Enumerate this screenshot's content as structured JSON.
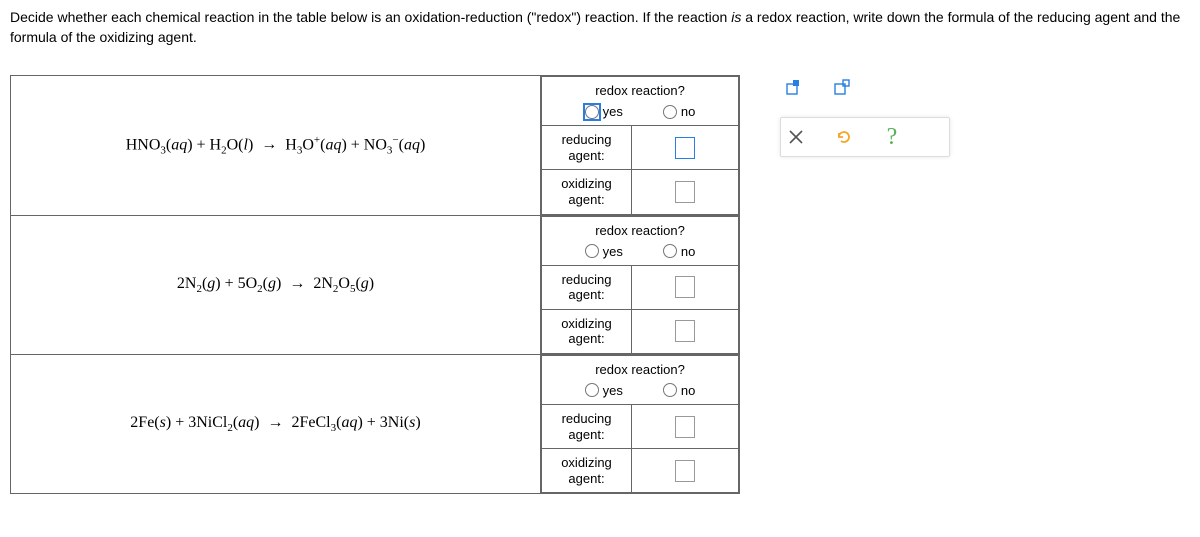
{
  "instructions": {
    "part1": "Decide whether each chemical reaction in the table below is an oxidation-reduction (\"redox\") reaction. If the reaction ",
    "emph": "is",
    "part2": " a redox reaction, write down the formula of the reducing agent and the formula of the oxidizing agent."
  },
  "labels": {
    "redox_q": "redox reaction?",
    "yes": "yes",
    "no": "no",
    "reducing": "reducing agent:",
    "oxidizing": "oxidizing agent:"
  },
  "reactions": [
    {
      "html": "HNO<span class='sub'>3</span>(<i>aq</i>) + H<span class='sub'>2</span>O(<i>l</i>) <span class='arrow'>→</span> H<span class='sub'>3</span>O<span class='sup'>+</span>(<i>aq</i>) + NO<span class='sub'>3</span><span class='sup'>−</span>(<i>aq</i>)",
      "yes_selected": true,
      "reducing": "",
      "oxidizing": ""
    },
    {
      "html": "2N<span class='sub'>2</span>(<i>g</i>) + 5O<span class='sub'>2</span>(<i>g</i>) <span class='arrow'>→</span> 2N<span class='sub'>2</span>O<span class='sub'>5</span>(<i>g</i>)",
      "yes_selected": false,
      "reducing": "",
      "oxidizing": ""
    },
    {
      "html": "2Fe(<i>s</i>) + 3NiCl<span class='sub'>2</span>(<i>aq</i>) <span class='arrow'>→</span> 2FeCl<span class='sub'>3</span>(<i>aq</i>) + 3Ni(<i>s</i>)",
      "yes_selected": false,
      "reducing": "",
      "oxidizing": ""
    }
  ]
}
